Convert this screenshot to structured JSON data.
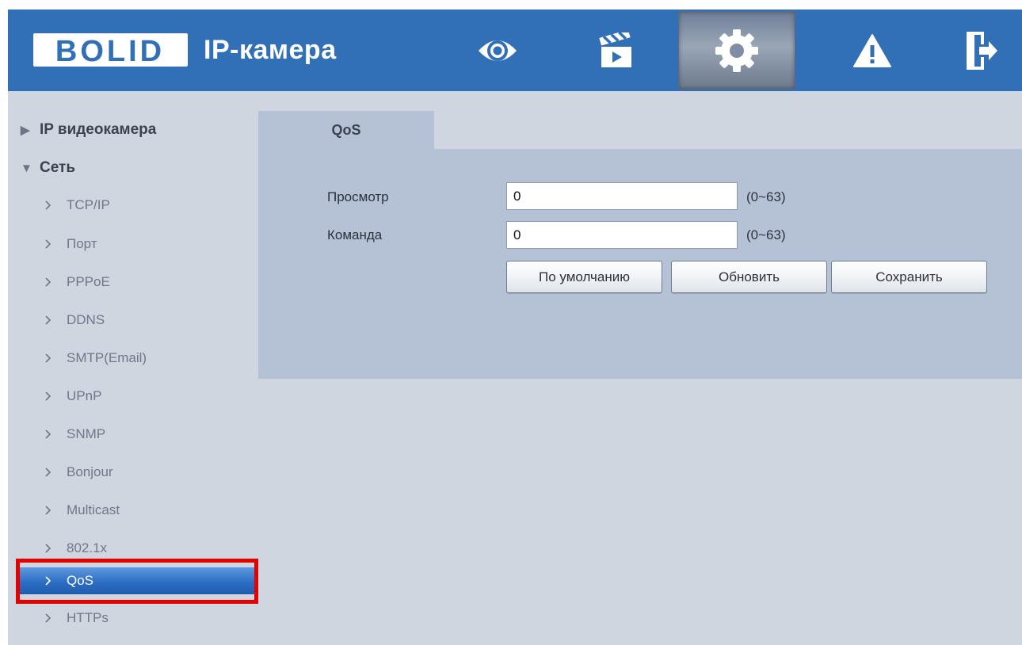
{
  "header": {
    "brand": "BOLID",
    "title": "IP-камера",
    "nav": [
      {
        "name": "live-view",
        "icon": "eye-icon"
      },
      {
        "name": "playback",
        "icon": "clapperboard-icon"
      },
      {
        "name": "settings",
        "icon": "gear-icon",
        "active": true
      },
      {
        "name": "alarm",
        "icon": "warning-icon"
      },
      {
        "name": "logout",
        "icon": "exit-door-icon"
      }
    ]
  },
  "sidebar": {
    "groups": [
      {
        "label": "IP видеокамера",
        "expanded": false,
        "marker": "▶"
      },
      {
        "label": "Сеть",
        "expanded": true,
        "marker": "▼"
      }
    ],
    "items": [
      {
        "label": "TCP/IP"
      },
      {
        "label": "Порт"
      },
      {
        "label": "PPPoE"
      },
      {
        "label": "DDNS"
      },
      {
        "label": "SMTP(Email)"
      },
      {
        "label": "UPnP"
      },
      {
        "label": "SNMP"
      },
      {
        "label": "Bonjour"
      },
      {
        "label": "Multicast"
      },
      {
        "label": "802.1x"
      },
      {
        "label": "QoS",
        "active": true
      },
      {
        "label": "HTTPs"
      }
    ]
  },
  "main": {
    "tab": "QoS",
    "fields": [
      {
        "label": "Просмотр",
        "value": "0",
        "range": "(0~63)"
      },
      {
        "label": "Команда",
        "value": "0",
        "range": "(0~63)"
      }
    ],
    "buttons": {
      "default": "По умолчанию",
      "refresh": "Обновить",
      "save": "Сохранить"
    }
  },
  "colors": {
    "header": "#316fb6",
    "background": "#cfd6e0",
    "panel": "#b5c2d6",
    "active_item": "#2d6ec3",
    "highlight": "#e50000"
  }
}
